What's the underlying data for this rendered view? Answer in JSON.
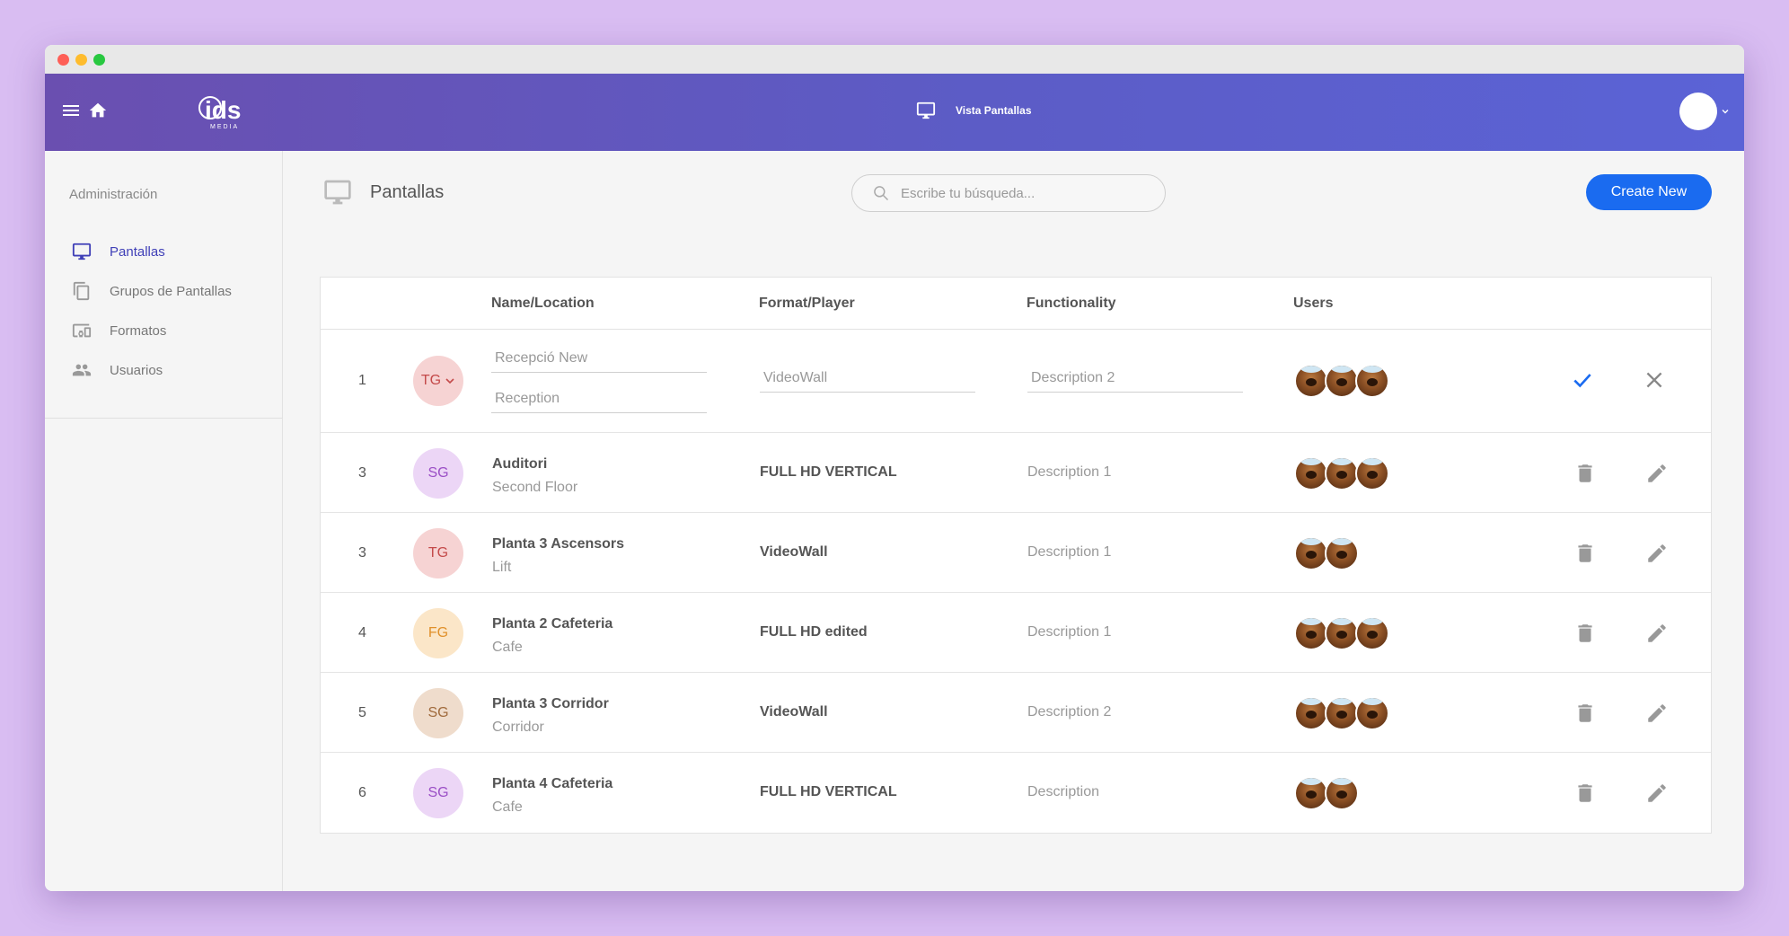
{
  "header": {
    "center_label": "Vista Pantallas",
    "logo_text": "ids",
    "logo_sub": "MEDIA"
  },
  "sidebar": {
    "section_title": "Administración",
    "items": [
      {
        "label": "Pantallas",
        "icon": "monitor-icon",
        "active": true
      },
      {
        "label": "Grupos de Pantallas",
        "icon": "copy-icon",
        "active": false
      },
      {
        "label": "Formatos",
        "icon": "devices-icon",
        "active": false
      },
      {
        "label": "Usuarios",
        "icon": "people-icon",
        "active": false
      }
    ]
  },
  "page": {
    "title": "Pantallas",
    "search_placeholder": "Escribe tu búsqueda...",
    "create_button": "Create New"
  },
  "table": {
    "headers": [
      "Name/Location",
      "Format/Player",
      "Functionality",
      "Users"
    ],
    "edit_row": {
      "num": "1",
      "badge": "TG",
      "name_placeholder": "Recepció New",
      "location_placeholder": "Reception",
      "format_placeholder": "VideoWall",
      "func_placeholder": "Description 2",
      "users": 3
    },
    "rows": [
      {
        "num": "3",
        "badge": "SG",
        "name": "Auditori",
        "location": "Second Floor",
        "format": "FULL HD VERTICAL",
        "func": "Description 1",
        "users": 3
      },
      {
        "num": "3",
        "badge": "TG",
        "name": "Planta 3 Ascensors",
        "location": "Lift",
        "format": "VideoWall",
        "func": "Description 1",
        "users": 2
      },
      {
        "num": "4",
        "badge": "FG",
        "name": "Planta 2 Cafeteria",
        "location": "Cafe",
        "format": "FULL HD edited",
        "func": "Description 1",
        "users": 3
      },
      {
        "num": "5",
        "badge": "SG",
        "name": "Planta 3 Corridor",
        "location": "Corridor",
        "format": "VideoWall",
        "func": "Description 2",
        "users": 3
      },
      {
        "num": "6",
        "badge": "SG",
        "name": "Planta 4 Cafeteria",
        "location": "Cafe",
        "format": "FULL HD VERTICAL",
        "func": "Description",
        "users": 2
      }
    ]
  },
  "colors": {
    "accent": "#1a6bf0",
    "nav_active": "#3f3fb7",
    "badge_TG_bg": "#f6d3d3",
    "badge_TG_fg": "#c44a4a",
    "badge_SG_bg": "#ecd6f6",
    "badge_SG_fg": "#9b4fc6",
    "badge_FG_bg": "#fbe6c8",
    "badge_FG_fg": "#e0902a",
    "badge_SG2_bg": "#efdccc",
    "badge_SG2_fg": "#a06a3c"
  }
}
